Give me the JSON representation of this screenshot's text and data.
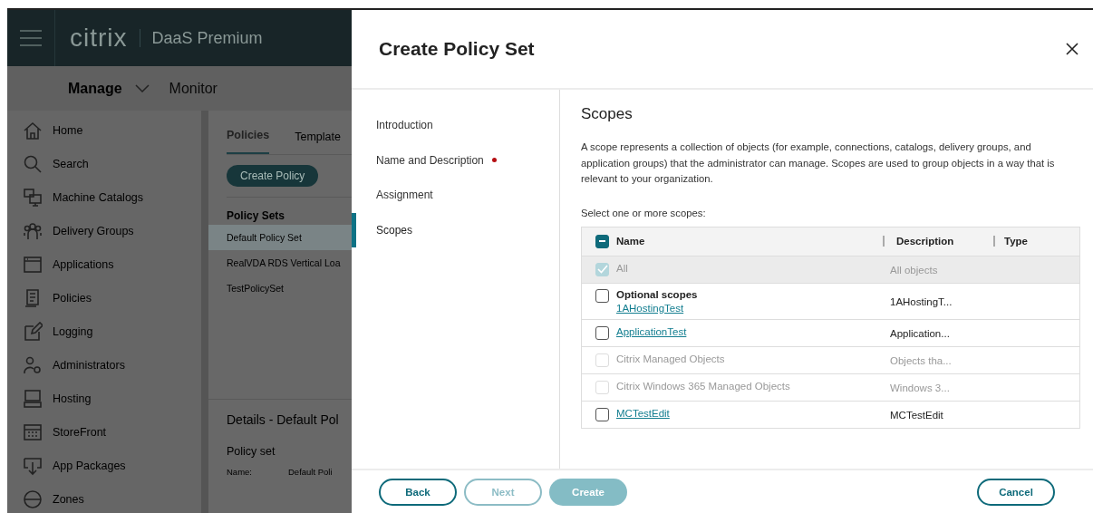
{
  "background_app": {
    "header": {
      "brand": "citrix",
      "product": "DaaS Premium"
    },
    "nav_tabs": [
      {
        "label": "Manage",
        "selected": true
      },
      {
        "label": "Monitor",
        "selected": false
      }
    ],
    "sidebar": {
      "items": [
        {
          "label": "Home"
        },
        {
          "label": "Search"
        },
        {
          "label": "Machine Catalogs"
        },
        {
          "label": "Delivery Groups"
        },
        {
          "label": "Applications"
        },
        {
          "label": "Policies"
        },
        {
          "label": "Logging"
        },
        {
          "label": "Administrators"
        },
        {
          "label": "Hosting"
        },
        {
          "label": "StoreFront"
        },
        {
          "label": "App Packages"
        },
        {
          "label": "Zones"
        }
      ]
    },
    "content": {
      "tabs": [
        {
          "label": "Policies",
          "selected": true
        },
        {
          "label": "Template",
          "selected": false
        }
      ],
      "create_button": "Create Policy",
      "policy_sets": {
        "heading": "Policy Sets",
        "items": [
          {
            "label": "Default Policy Set",
            "selected": true
          },
          {
            "label": "RealVDA RDS Vertical Loa",
            "selected": false
          },
          {
            "label": "TestPolicySet",
            "selected": false
          }
        ]
      },
      "details": {
        "title": "Details - Default Pol",
        "section": "Policy set",
        "field_label": "Name:",
        "field_value": "Default Poli"
      }
    }
  },
  "dialog": {
    "title": "Create Policy Set",
    "steps": [
      {
        "label": "Introduction",
        "selected": false,
        "required": false
      },
      {
        "label": "Name and Description",
        "selected": false,
        "required": true
      },
      {
        "label": "Assignment",
        "selected": false,
        "required": false
      },
      {
        "label": "Scopes",
        "selected": true,
        "required": false
      }
    ],
    "heading": "Scopes",
    "description": "A scope represents a collection of objects (for example, connections, catalogs, delivery groups, and application groups) that the administrator can manage. Scopes are used to group objects in a way that is relevant to your organization.",
    "prompt": "Select one or more scopes:",
    "table": {
      "columns": [
        "Name",
        "Description",
        "Type"
      ],
      "select_all_indeterminate": true,
      "rows": [
        {
          "name": "All",
          "description": "All objects",
          "checked": true,
          "disabled": true,
          "link": false
        },
        {
          "group_label": "Optional scopes",
          "name": "1AHostingTest",
          "description": "1AHostingT...",
          "checked": false,
          "disabled": false,
          "link": true
        },
        {
          "name": "ApplicationTest",
          "description": "Application...",
          "checked": false,
          "disabled": false,
          "link": true
        },
        {
          "name": "Citrix Managed Objects",
          "description": "Objects tha...",
          "checked": false,
          "disabled": true,
          "link": false
        },
        {
          "name": "Citrix Windows 365 Managed Objects",
          "description": "Windows 3...",
          "checked": false,
          "disabled": true,
          "link": false
        },
        {
          "name": "MCTestEdit",
          "description": "MCTestEdit",
          "checked": false,
          "disabled": false,
          "link": true
        }
      ]
    },
    "buttons": [
      {
        "label": "Back",
        "kind": "outline",
        "disabled": false
      },
      {
        "label": "Next",
        "kind": "outline",
        "disabled": true
      },
      {
        "label": "Create",
        "kind": "primary",
        "disabled": true
      },
      {
        "label": "Cancel",
        "kind": "outline",
        "disabled": false
      }
    ]
  }
}
